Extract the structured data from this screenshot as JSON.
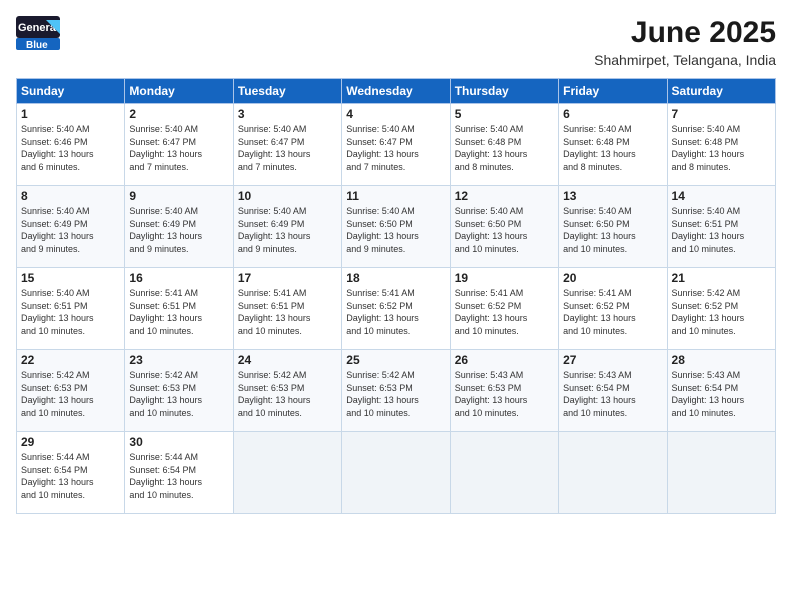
{
  "header": {
    "logo_general": "General",
    "logo_blue": "Blue",
    "title": "June 2025",
    "subtitle": "Shahmirpet, Telangana, India"
  },
  "calendar": {
    "headers": [
      "Sunday",
      "Monday",
      "Tuesday",
      "Wednesday",
      "Thursday",
      "Friday",
      "Saturday"
    ],
    "rows": [
      [
        {
          "day": "1",
          "info": "Sunrise: 5:40 AM\nSunset: 6:46 PM\nDaylight: 13 hours\nand 6 minutes."
        },
        {
          "day": "2",
          "info": "Sunrise: 5:40 AM\nSunset: 6:47 PM\nDaylight: 13 hours\nand 7 minutes."
        },
        {
          "day": "3",
          "info": "Sunrise: 5:40 AM\nSunset: 6:47 PM\nDaylight: 13 hours\nand 7 minutes."
        },
        {
          "day": "4",
          "info": "Sunrise: 5:40 AM\nSunset: 6:47 PM\nDaylight: 13 hours\nand 7 minutes."
        },
        {
          "day": "5",
          "info": "Sunrise: 5:40 AM\nSunset: 6:48 PM\nDaylight: 13 hours\nand 8 minutes."
        },
        {
          "day": "6",
          "info": "Sunrise: 5:40 AM\nSunset: 6:48 PM\nDaylight: 13 hours\nand 8 minutes."
        },
        {
          "day": "7",
          "info": "Sunrise: 5:40 AM\nSunset: 6:48 PM\nDaylight: 13 hours\nand 8 minutes."
        }
      ],
      [
        {
          "day": "8",
          "info": "Sunrise: 5:40 AM\nSunset: 6:49 PM\nDaylight: 13 hours\nand 9 minutes."
        },
        {
          "day": "9",
          "info": "Sunrise: 5:40 AM\nSunset: 6:49 PM\nDaylight: 13 hours\nand 9 minutes."
        },
        {
          "day": "10",
          "info": "Sunrise: 5:40 AM\nSunset: 6:49 PM\nDaylight: 13 hours\nand 9 minutes."
        },
        {
          "day": "11",
          "info": "Sunrise: 5:40 AM\nSunset: 6:50 PM\nDaylight: 13 hours\nand 9 minutes."
        },
        {
          "day": "12",
          "info": "Sunrise: 5:40 AM\nSunset: 6:50 PM\nDaylight: 13 hours\nand 10 minutes."
        },
        {
          "day": "13",
          "info": "Sunrise: 5:40 AM\nSunset: 6:50 PM\nDaylight: 13 hours\nand 10 minutes."
        },
        {
          "day": "14",
          "info": "Sunrise: 5:40 AM\nSunset: 6:51 PM\nDaylight: 13 hours\nand 10 minutes."
        }
      ],
      [
        {
          "day": "15",
          "info": "Sunrise: 5:40 AM\nSunset: 6:51 PM\nDaylight: 13 hours\nand 10 minutes."
        },
        {
          "day": "16",
          "info": "Sunrise: 5:41 AM\nSunset: 6:51 PM\nDaylight: 13 hours\nand 10 minutes."
        },
        {
          "day": "17",
          "info": "Sunrise: 5:41 AM\nSunset: 6:51 PM\nDaylight: 13 hours\nand 10 minutes."
        },
        {
          "day": "18",
          "info": "Sunrise: 5:41 AM\nSunset: 6:52 PM\nDaylight: 13 hours\nand 10 minutes."
        },
        {
          "day": "19",
          "info": "Sunrise: 5:41 AM\nSunset: 6:52 PM\nDaylight: 13 hours\nand 10 minutes."
        },
        {
          "day": "20",
          "info": "Sunrise: 5:41 AM\nSunset: 6:52 PM\nDaylight: 13 hours\nand 10 minutes."
        },
        {
          "day": "21",
          "info": "Sunrise: 5:42 AM\nSunset: 6:52 PM\nDaylight: 13 hours\nand 10 minutes."
        }
      ],
      [
        {
          "day": "22",
          "info": "Sunrise: 5:42 AM\nSunset: 6:53 PM\nDaylight: 13 hours\nand 10 minutes."
        },
        {
          "day": "23",
          "info": "Sunrise: 5:42 AM\nSunset: 6:53 PM\nDaylight: 13 hours\nand 10 minutes."
        },
        {
          "day": "24",
          "info": "Sunrise: 5:42 AM\nSunset: 6:53 PM\nDaylight: 13 hours\nand 10 minutes."
        },
        {
          "day": "25",
          "info": "Sunrise: 5:42 AM\nSunset: 6:53 PM\nDaylight: 13 hours\nand 10 minutes."
        },
        {
          "day": "26",
          "info": "Sunrise: 5:43 AM\nSunset: 6:53 PM\nDaylight: 13 hours\nand 10 minutes."
        },
        {
          "day": "27",
          "info": "Sunrise: 5:43 AM\nSunset: 6:54 PM\nDaylight: 13 hours\nand 10 minutes."
        },
        {
          "day": "28",
          "info": "Sunrise: 5:43 AM\nSunset: 6:54 PM\nDaylight: 13 hours\nand 10 minutes."
        }
      ],
      [
        {
          "day": "29",
          "info": "Sunrise: 5:44 AM\nSunset: 6:54 PM\nDaylight: 13 hours\nand 10 minutes."
        },
        {
          "day": "30",
          "info": "Sunrise: 5:44 AM\nSunset: 6:54 PM\nDaylight: 13 hours\nand 10 minutes."
        },
        {
          "day": "",
          "info": ""
        },
        {
          "day": "",
          "info": ""
        },
        {
          "day": "",
          "info": ""
        },
        {
          "day": "",
          "info": ""
        },
        {
          "day": "",
          "info": ""
        }
      ]
    ]
  }
}
